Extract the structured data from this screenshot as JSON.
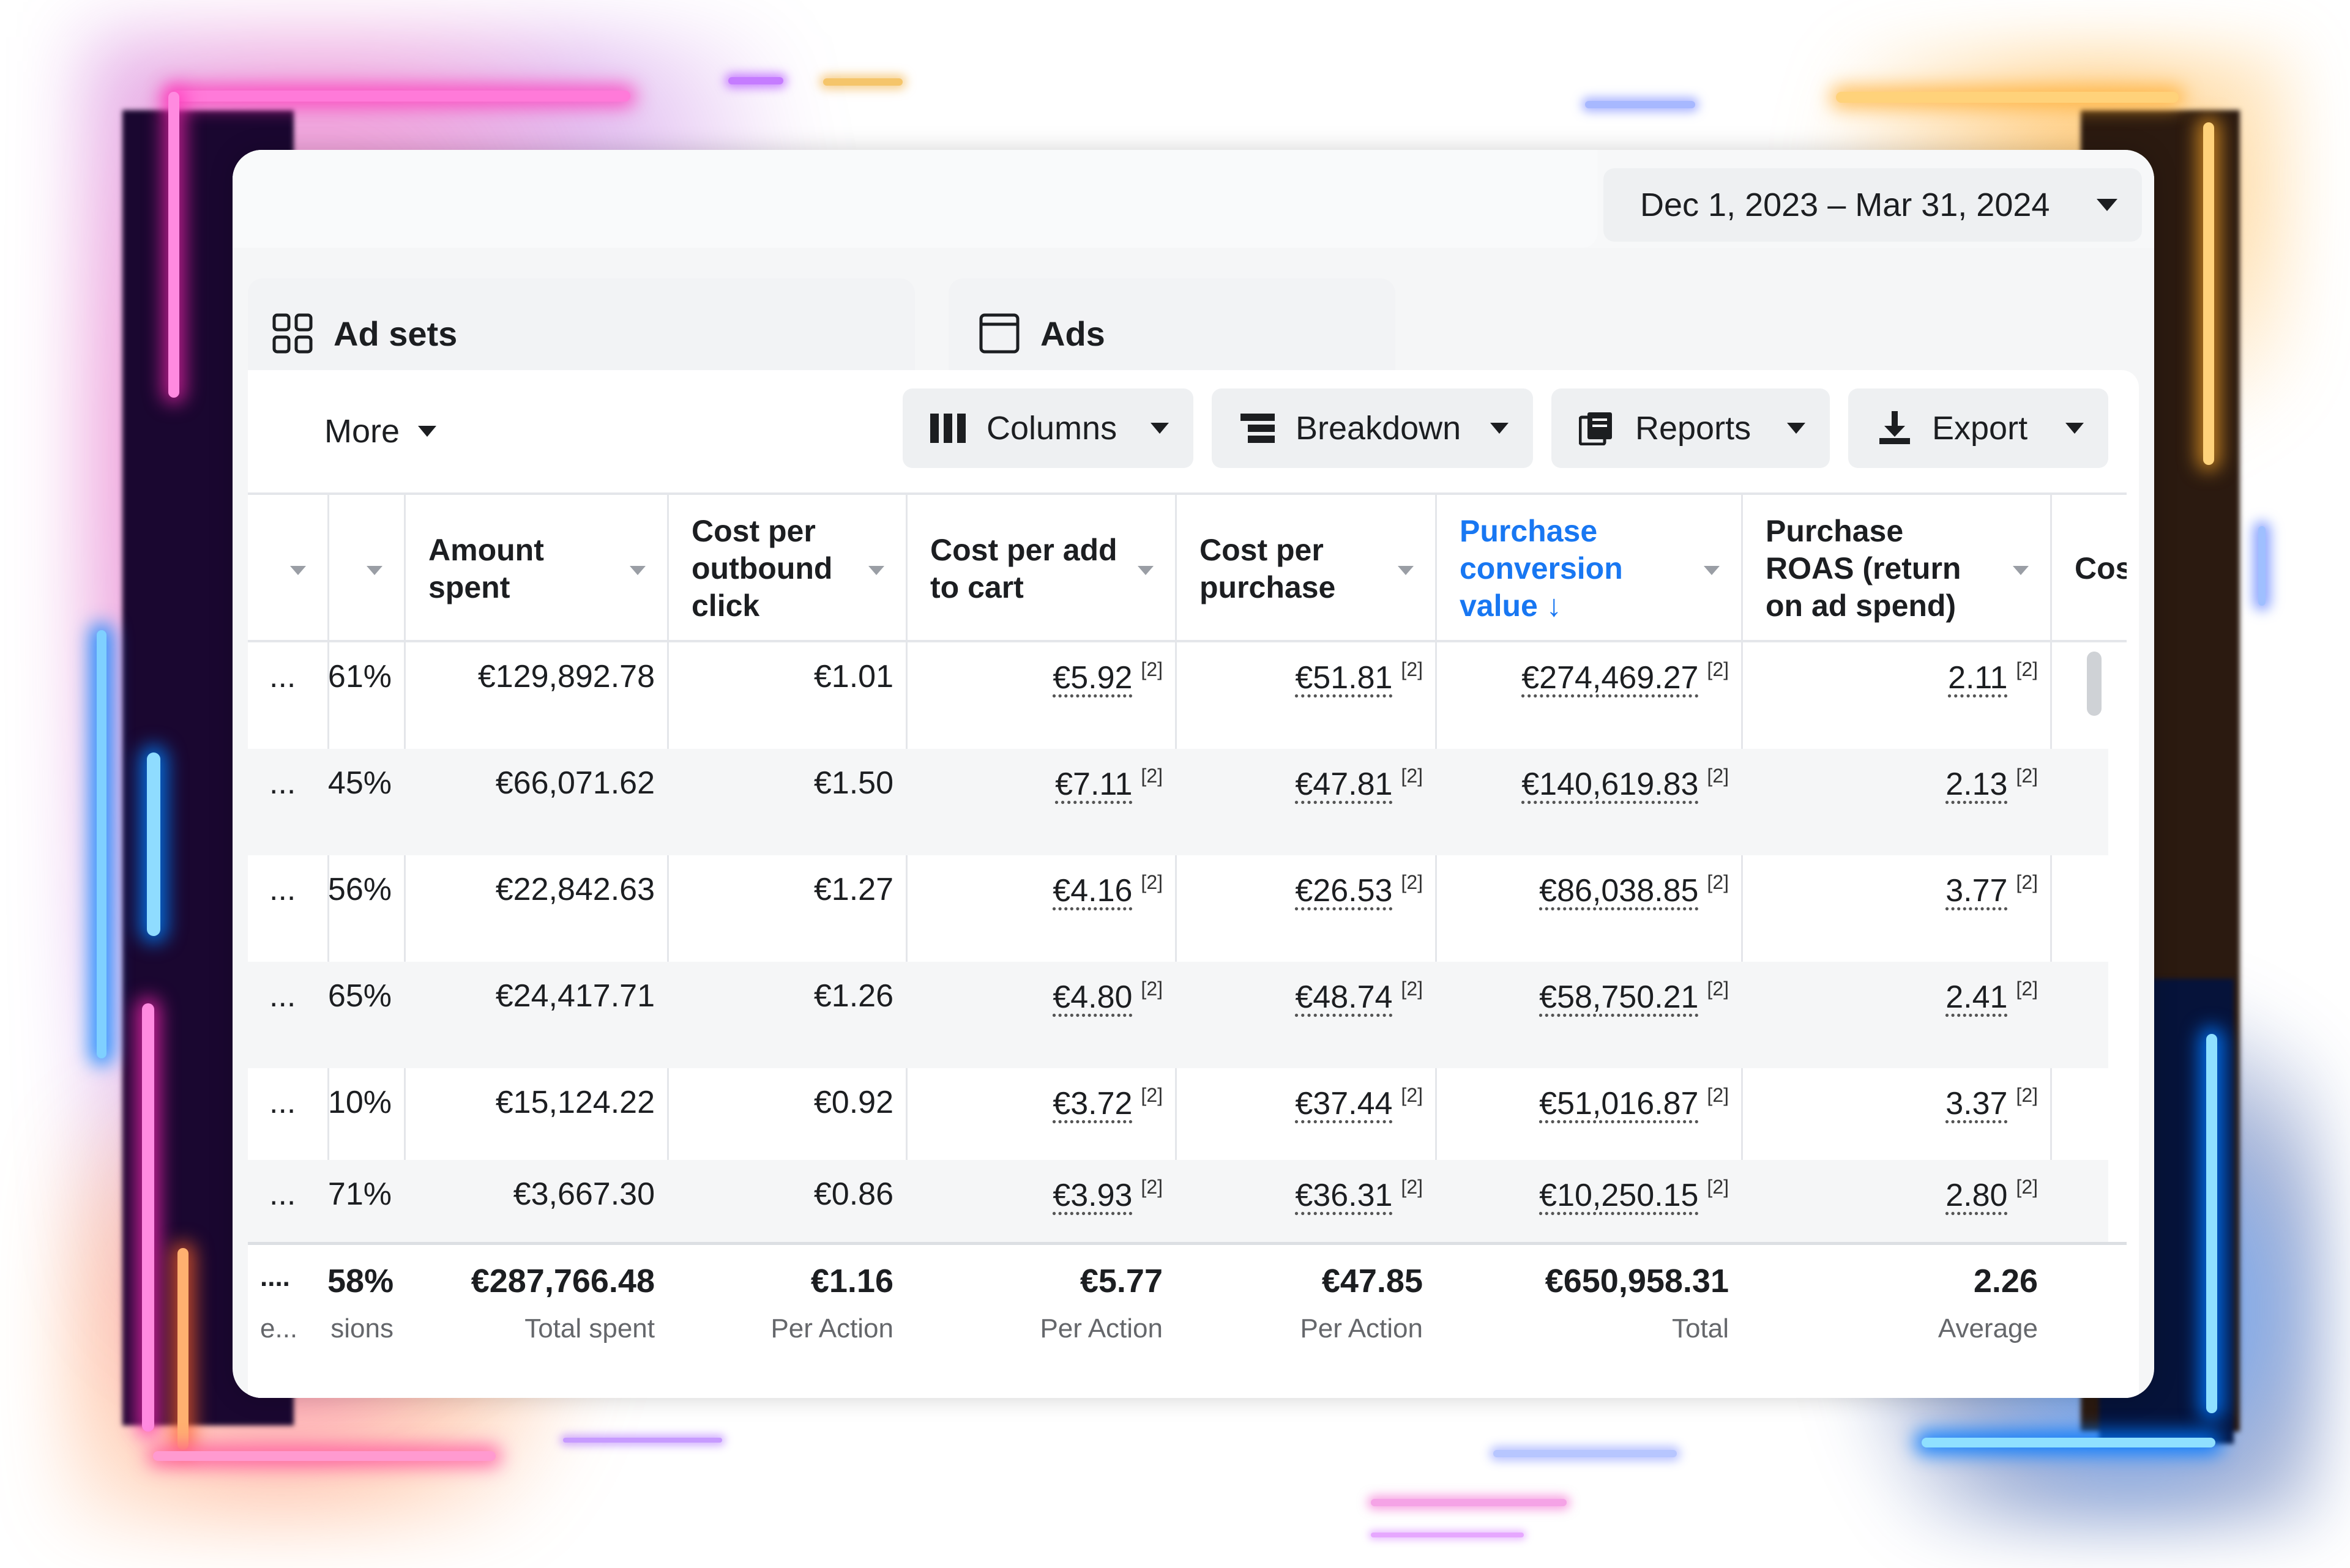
{
  "date_range": "Dec 1, 2023 – Mar 31, 2024",
  "tabs": [
    {
      "label": "Ad sets",
      "icon": "grid-icon"
    },
    {
      "label": "Ads",
      "icon": "ad-frame-icon"
    }
  ],
  "toolbar": {
    "more_label": "More",
    "columns_label": "Columns",
    "breakdown_label": "Breakdown",
    "reports_label": "Reports",
    "export_label": "Export"
  },
  "table": {
    "columns": [
      {
        "key": "amount_spent",
        "label": "Amount spent"
      },
      {
        "key": "cost_per_outbound_click",
        "label": "Cost per outbound click"
      },
      {
        "key": "cost_per_add_to_cart",
        "label": "Cost per add to cart"
      },
      {
        "key": "cost_per_purchase",
        "label": "Cost per purchase"
      },
      {
        "key": "purchase_conversion_value",
        "label": "Purchase conversion value",
        "sorted": "desc"
      },
      {
        "key": "purchase_roas",
        "label": "Purchase ROAS (return on ad spend)"
      },
      {
        "key": "cost_partial",
        "label": "Cos"
      }
    ],
    "footnote_marker": "[2]",
    "row_ellipsis": "...",
    "rows": [
      {
        "pct": "61%",
        "amount_spent": "€129,892.78",
        "cpoc": "€1.01",
        "cpatc": "€5.92",
        "cpp": "€51.81",
        "pcv": "€274,469.27",
        "roas": "2.11"
      },
      {
        "pct": "45%",
        "amount_spent": "€66,071.62",
        "cpoc": "€1.50",
        "cpatc": "€7.11",
        "cpp": "€47.81",
        "pcv": "€140,619.83",
        "roas": "2.13"
      },
      {
        "pct": "56%",
        "amount_spent": "€22,842.63",
        "cpoc": "€1.27",
        "cpatc": "€4.16",
        "cpp": "€26.53",
        "pcv": "€86,038.85",
        "roas": "3.77"
      },
      {
        "pct": "65%",
        "amount_spent": "€24,417.71",
        "cpoc": "€1.26",
        "cpatc": "€4.80",
        "cpp": "€48.74",
        "pcv": "€58,750.21",
        "roas": "2.41"
      },
      {
        "pct": "10%",
        "amount_spent": "€15,124.22",
        "cpoc": "€0.92",
        "cpatc": "€3.72",
        "cpp": "€37.44",
        "pcv": "€51,016.87",
        "roas": "3.37"
      },
      {
        "pct": "71%",
        "amount_spent": "€3,667.30",
        "cpoc": "€0.86",
        "cpatc": "€3.93",
        "cpp": "€36.31",
        "pcv": "€10,250.15",
        "roas": "2.80"
      }
    ],
    "totals": {
      "first": "....",
      "first_sub": "e...",
      "pct": "58%",
      "pct_sub": "sions",
      "amount_spent": "€287,766.48",
      "amount_spent_sub": "Total spent",
      "cpoc": "€1.16",
      "cpoc_sub": "Per Action",
      "cpatc": "€5.77",
      "cpatc_sub": "Per Action",
      "cpp": "€47.85",
      "cpp_sub": "Per Action",
      "pcv": "€650,958.31",
      "pcv_sub": "Total",
      "roas": "2.26",
      "roas_sub": "Average"
    }
  },
  "colors": {
    "accent_blue": "#1877f2",
    "text": "#1c1e21",
    "muted": "#65676b",
    "row_alt": "#f5f6f7"
  }
}
